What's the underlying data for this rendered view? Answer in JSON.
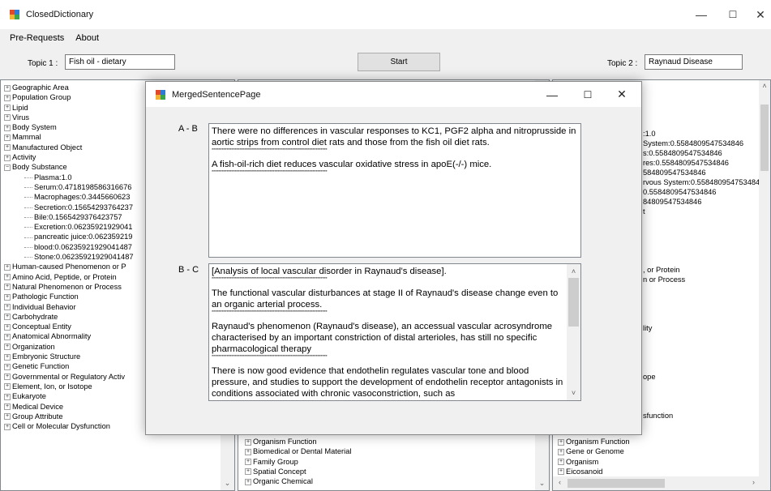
{
  "window": {
    "title": "ClosedDictionary",
    "minimize": "—",
    "maximize": "☐",
    "close": "✕"
  },
  "menu": [
    "Pre-Requests",
    "About"
  ],
  "toolbar": {
    "topic1_label": "Topic 1 :",
    "topic1_value": "Fish oil - dietary",
    "start_label": "Start",
    "topic2_label": "Topic 2 :",
    "topic2_value": "Raynaud Disease"
  },
  "left_tree": [
    {
      "t": "Geographic Area",
      "exp": "+"
    },
    {
      "t": "Population Group",
      "exp": "+"
    },
    {
      "t": "Lipid",
      "exp": "+"
    },
    {
      "t": "Virus",
      "exp": "+"
    },
    {
      "t": "Body System",
      "exp": "+"
    },
    {
      "t": "Mammal",
      "exp": "+"
    },
    {
      "t": "Manufactured Object",
      "exp": "+"
    },
    {
      "t": "Activity",
      "exp": "+"
    },
    {
      "t": "Body Substance",
      "exp": "−"
    },
    {
      "t": "Plasma:1.0",
      "child": true
    },
    {
      "t": "Serum:0.4718198586316676",
      "child": true
    },
    {
      "t": "Macrophages:0.3445660623",
      "child": true
    },
    {
      "t": "Secretion:0.15654293764237",
      "child": true
    },
    {
      "t": "Bile:0.1565429376423757",
      "child": true
    },
    {
      "t": "Excretion:0.06235921929041",
      "child": true
    },
    {
      "t": "pancreatic juice:0.062359219",
      "child": true
    },
    {
      "t": "blood:0.06235921929041487",
      "child": true
    },
    {
      "t": "Stone:0.06235921929041487",
      "child": true
    },
    {
      "t": "Human-caused Phenomenon or P",
      "exp": "+"
    },
    {
      "t": "Amino Acid, Peptide, or Protein",
      "exp": "+"
    },
    {
      "t": "Natural Phenomenon or Process",
      "exp": "+"
    },
    {
      "t": "Pathologic Function",
      "exp": "+"
    },
    {
      "t": "Individual Behavior",
      "exp": "+"
    },
    {
      "t": "Carbohydrate",
      "exp": "+"
    },
    {
      "t": "Conceptual Entity",
      "exp": "+"
    },
    {
      "t": "Anatomical Abnormality",
      "exp": "+"
    },
    {
      "t": "Organization",
      "exp": "+"
    },
    {
      "t": "Embryonic Structure",
      "exp": "+"
    },
    {
      "t": "Genetic Function",
      "exp": "+"
    },
    {
      "t": "Governmental or Regulatory Activ",
      "exp": "+"
    },
    {
      "t": "Element, Ion, or Isotope",
      "exp": "+"
    },
    {
      "t": "Eukaryote",
      "exp": "+"
    },
    {
      "t": "Medical Device",
      "exp": "+"
    },
    {
      "t": "Group Attribute",
      "exp": "+"
    },
    {
      "t": "Cell or Molecular Dysfunction",
      "exp": "+"
    }
  ],
  "middle_tree_bottom": [
    "Organism Function",
    "Biomedical or Dental Material",
    "Family Group",
    "Spatial Concept",
    "Organic Chemical"
  ],
  "right_tree_partial": [
    ":1.0",
    "System:0.5584809547534846",
    "s:0.5584809547534846",
    "res:0.5584809547534846",
    "584809547534846",
    "rvous System:0.558480954753484",
    "0.5584809547534846",
    "84809547534846",
    "t",
    ", or Protein",
    "n or Process",
    "lity",
    "ope",
    "sfunction"
  ],
  "right_tree_bottom": [
    "Organism Function",
    "Gene or Genome",
    "Organism",
    "Eicosanoid"
  ],
  "dialog": {
    "title": "MergedSentencePage",
    "minimize": "—",
    "maximize": "☐",
    "close": "✕",
    "ab_label": "A - B",
    "bc_label": "B - C",
    "separator": "**********************************************************************",
    "ab_sentences": [
      "There were no differences in vascular responses to KC1, PGF2 alpha and nitroprusside in aortic strips from control diet rats and those from the fish oil diet rats.",
      "A fish-oil-rich diet reduces vascular oxidative stress in apoE(-/-) mice."
    ],
    "bc_sentences": [
      "[Analysis of local vascular disorder in Raynaud's disease].",
      " The functional vascular disturbances at stage II of Raynaud's disease change even to an organic arterial process.",
      "Raynaud's phenomenon (Raynaud's disease), an accessual vascular acrosyndrome characterised by an important constriction of distal arterioles, has still no specific pharmacological therapy",
      " There is now good evidence that endothelin regulates vascular tone and blood pressure, and studies to support the development of endothelin receptor antagonists in conditions associated with chronic vasoconstriction, such as"
    ]
  },
  "colors": {
    "window_bg": "#f0f0f0",
    "panel_bg": "#ffffff",
    "border": "#828790"
  }
}
